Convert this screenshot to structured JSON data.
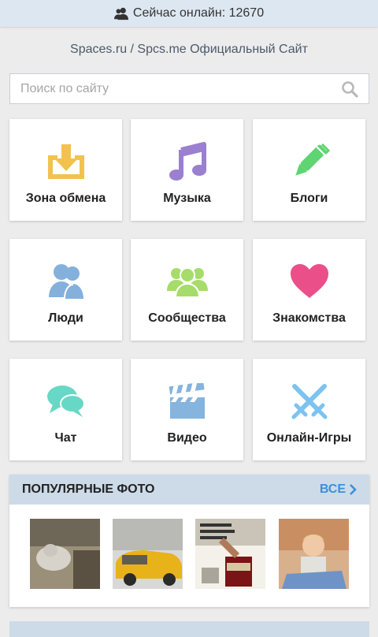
{
  "topbar": {
    "online_text": "Сейчас онлайн: 12670",
    "icon": "people-icon"
  },
  "header": {
    "site_title": "Spaces.ru / Spcs.me Официальный Сайт"
  },
  "search": {
    "placeholder": "Поиск по сайту",
    "value": "",
    "icon": "search-icon"
  },
  "tiles": [
    {
      "label": "Зона обмена",
      "icon": "download-icon",
      "color": "#f2c24e"
    },
    {
      "label": "Музыка",
      "icon": "music-note-icon",
      "color": "#9a80cf"
    },
    {
      "label": "Блоги",
      "icon": "pen-icon",
      "color": "#5fd472"
    },
    {
      "label": "Люди",
      "icon": "people-icon",
      "color": "#84b0dc"
    },
    {
      "label": "Сообщества",
      "icon": "community-icon",
      "color": "#a6dc6a"
    },
    {
      "label": "Знакомства",
      "icon": "heart-icon",
      "color": "#ea4f8a"
    },
    {
      "label": "Чат",
      "icon": "chat-icon",
      "color": "#67d8c5"
    },
    {
      "label": "Видео",
      "icon": "clapperboard-icon",
      "color": "#85b4de"
    },
    {
      "label": "Онлайн-Игры",
      "icon": "crossed-swords-icon",
      "color": "#7cc3f0"
    }
  ],
  "popular_photos": {
    "title": "ПОПУЛЯРНЫЕ ФОТО",
    "all_link": "ВСЕ",
    "accent": "#3d8fd9",
    "header_bg": "#cddbe8"
  }
}
